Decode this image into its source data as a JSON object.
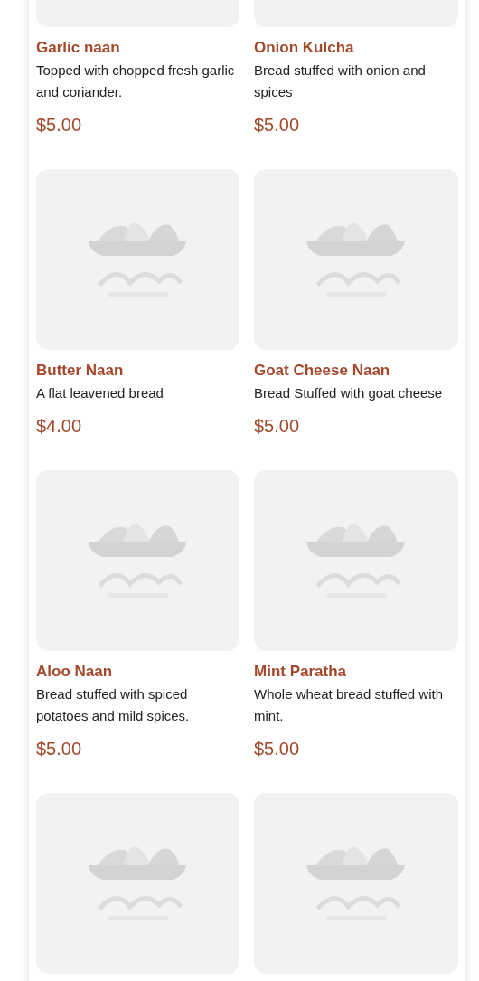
{
  "menu_items": [
    {
      "picture": {
        "kind": "picture"
      },
      "name": "Garlic naan",
      "description": "Topped with chopped fresh garlic and coriander.",
      "price": "$5.00"
    },
    {
      "picture": {
        "kind": "picture"
      },
      "name": "Onion Kulcha",
      "description": "Bread stuffed with onion and spices",
      "price": "$5.00"
    },
    {
      "picture": {
        "kind": "picture"
      },
      "name": "Butter Naan",
      "description": "A flat leavened bread",
      "price": "$4.00"
    },
    {
      "picture": {
        "kind": "picture"
      },
      "name": "Goat Cheese Naan",
      "description": "Bread Stuffed with goat cheese",
      "price": "$5.00"
    },
    {
      "picture": {
        "kind": "picture"
      },
      "name": "Aloo Naan",
      "description": "Bread stuffed with spiced potatoes and mild spices.",
      "price": "$5.00"
    },
    {
      "picture": {
        "kind": "picture"
      },
      "name": "Mint Paratha",
      "description": "Whole wheat bread stuffed with mint.",
      "price": "$5.00"
    },
    {
      "picture": {
        "kind": "picture"
      }
    },
    {
      "picture": {
        "kind": "picture"
      }
    }
  ]
}
